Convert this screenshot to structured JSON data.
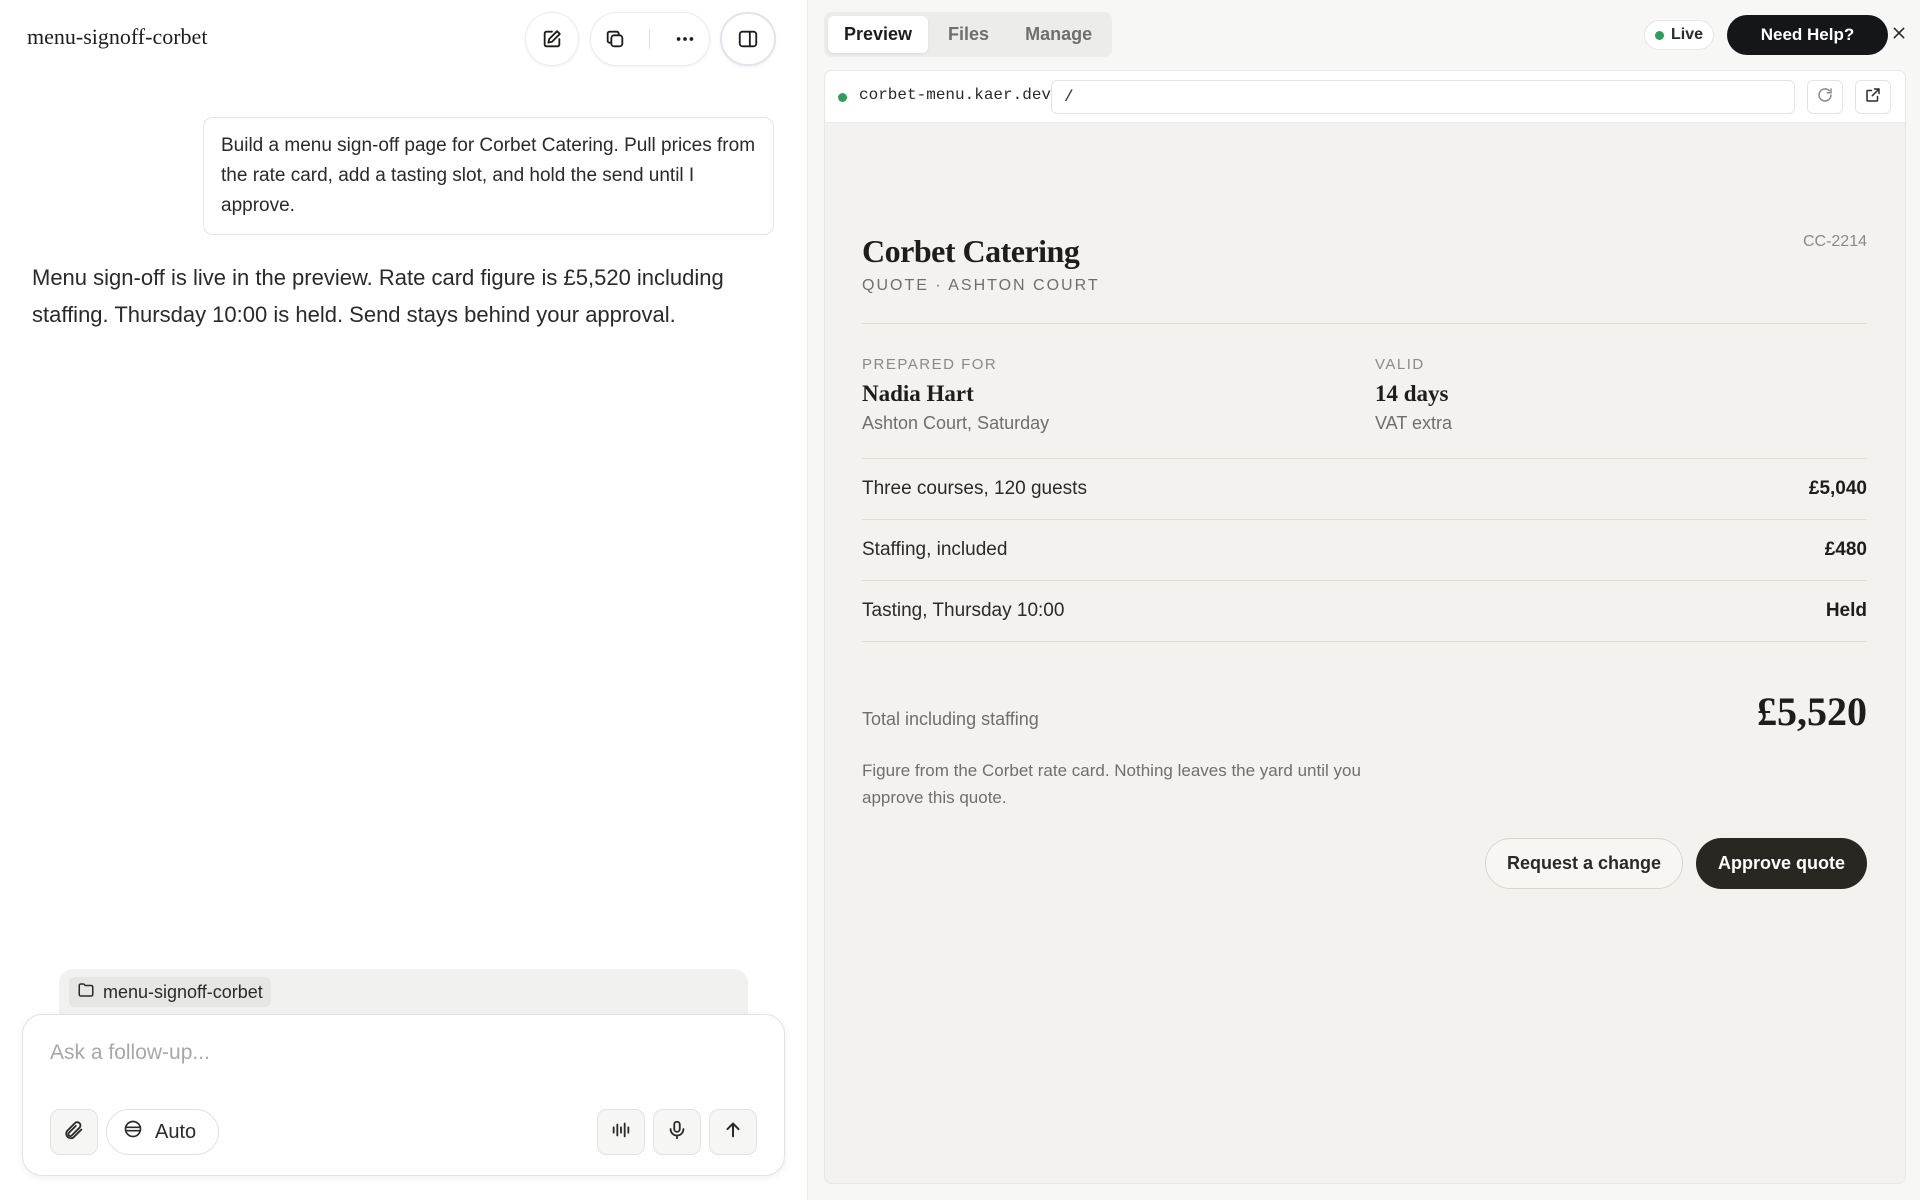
{
  "left": {
    "project_title": "menu-signoff-corbet",
    "user_message": "Build a menu sign-off page for Corbet Catering. Pull prices from the rate card, add a tasting slot, and hold the send until I approve.",
    "assistant_message": "Menu sign-off is live in the preview. Rate card figure is £5,520 including staffing. Thursday 10:00 is held. Send stays behind your approval.",
    "folder_chip": "menu-signoff-corbet",
    "composer": {
      "placeholder": "Ask a follow-up...",
      "mode_label": "Auto"
    }
  },
  "right": {
    "tabs": [
      "Preview",
      "Files",
      "Manage"
    ],
    "active_tab": "Preview",
    "live_label": "Live",
    "help_label": "Need Help?",
    "url_host": "corbet-menu.kaer.dev",
    "url_path": "/",
    "quote": {
      "title": "Corbet Catering",
      "subtitle": "QUOTE · ASHTON COURT",
      "reference": "CC-2214",
      "prepared_for_label": "PREPARED FOR",
      "prepared_for_name": "Nadia Hart",
      "prepared_for_note": "Ashton Court, Saturday",
      "valid_label": "VALID",
      "valid_value": "14 days",
      "valid_note": "VAT extra",
      "items": [
        {
          "label": "Three courses, 120 guests",
          "amount": "£5,040"
        },
        {
          "label": "Staffing, included",
          "amount": "£480"
        },
        {
          "label": "Tasting, Thursday 10:00",
          "amount": "Held"
        }
      ],
      "total_label": "Total including staffing",
      "total_value": "£5,520",
      "footnote": "Figure from the Corbet rate card. Nothing leaves the yard until you approve this quote.",
      "request_change_label": "Request a change",
      "approve_label": "Approve quote"
    }
  },
  "colors": {
    "live_dot": "#2f9e5c",
    "primary_dark": "#2a2622",
    "help_button": "#15161a",
    "preview_bg": "#f4f2ee"
  }
}
